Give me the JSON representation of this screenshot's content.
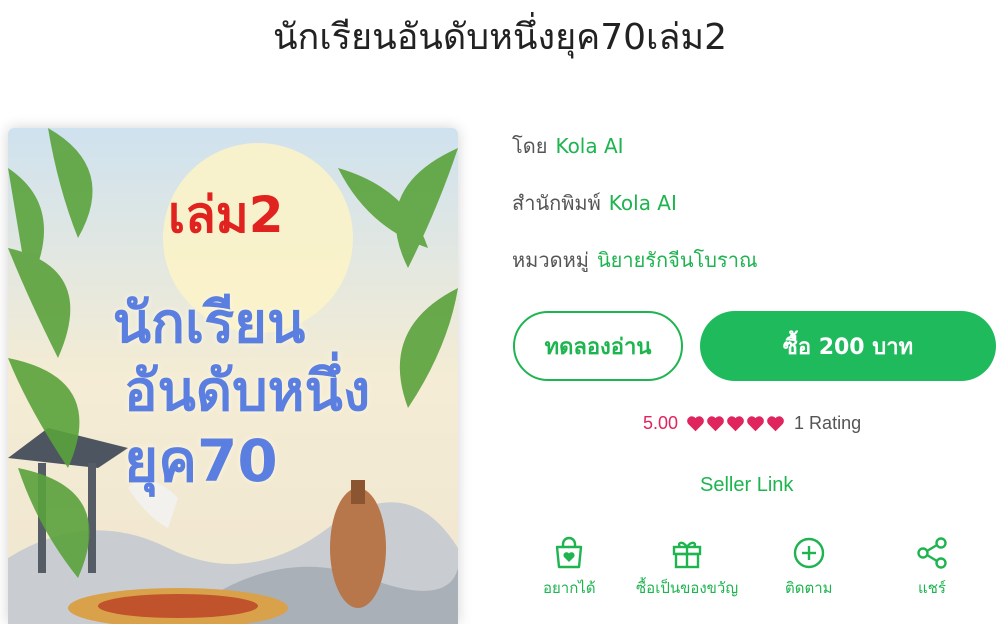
{
  "title": "นักเรียนอันดับหนึ่งยุค70เล่ม2",
  "cover": {
    "volume": "เล่ม2",
    "line1": "นักเรียน",
    "line2": "อันดับหนึ่ง",
    "line3": "ยุค70"
  },
  "meta": {
    "author_label": "โดย",
    "author": "Kola AI",
    "publisher_label": "สำนักพิมพ์",
    "publisher": "Kola AI",
    "category_label": "หมวดหมู่",
    "category": "นิยายรักจีนโบราณ"
  },
  "buttons": {
    "trial": "ทดลองอ่าน",
    "buy": "ซื้อ 200 บาท"
  },
  "rating": {
    "score": "5.00",
    "count": "1 Rating",
    "hearts": 5
  },
  "seller_link": "Seller Link",
  "actions": {
    "wishlist": "อยากได้",
    "gift": "ซื้อเป็นของขวัญ",
    "follow": "ติดตาม",
    "share": "แชร์"
  },
  "colors": {
    "accent": "#1eb44f",
    "buy_bg": "#1eba5c",
    "heart": "#e0245e"
  }
}
